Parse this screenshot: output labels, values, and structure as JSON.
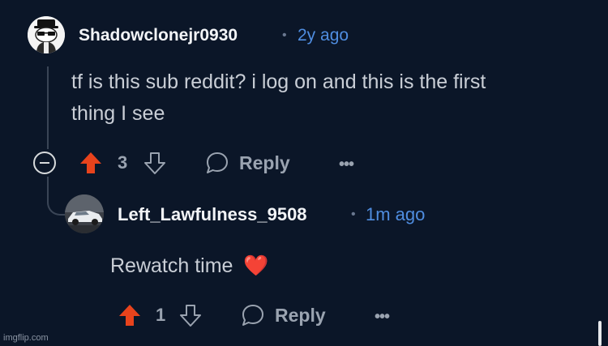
{
  "comments": [
    {
      "username": "Shadowclonejr0930",
      "separator": "•",
      "timestamp": "2y ago",
      "body_lines": [
        "tf is this sub reddit? i log on and this is the first",
        "thing I see"
      ],
      "vote_count": "3",
      "reply_label": "Reply",
      "more_label": "•••",
      "avatar_icon": "snoo-avatar-icon"
    },
    {
      "username": "Left_Lawfulness_9508",
      "separator": "•",
      "timestamp": "1m ago",
      "body_text": "Rewatch time",
      "body_emoji": "❤️",
      "vote_count": "1",
      "reply_label": "Reply",
      "more_label": "•••",
      "avatar_icon": "car-avatar-icon"
    }
  ],
  "watermark": "imgflip.com",
  "colors": {
    "background": "#0b1628",
    "upvote_active": "#e8431c",
    "timestamp": "#4f8de0",
    "thread_line": "#3a4556"
  }
}
